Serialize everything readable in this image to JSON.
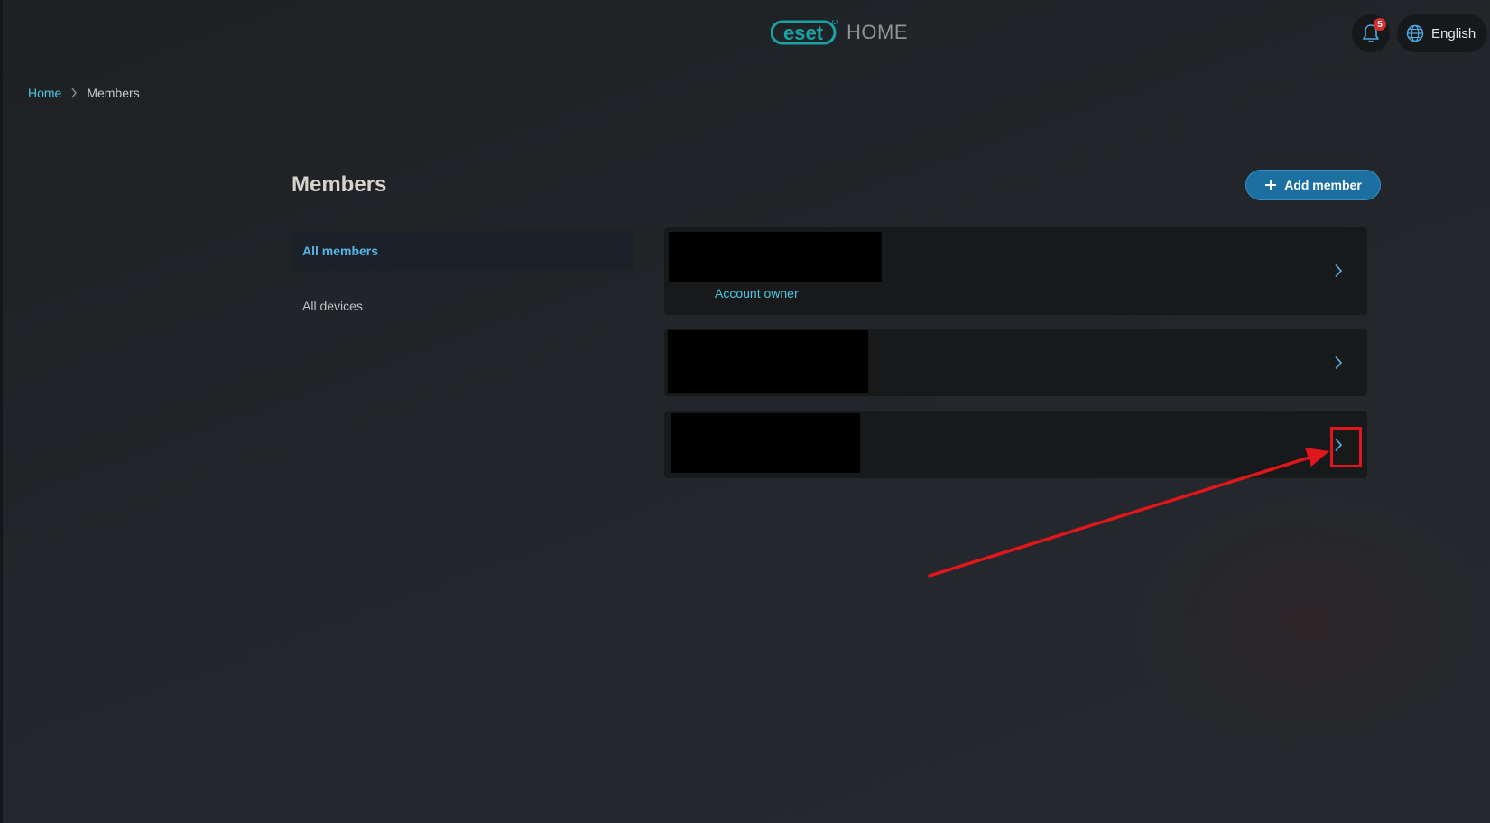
{
  "header": {
    "logo_text": "eset",
    "logo_suffix": "HOME",
    "notifications_count": "5",
    "language": "English"
  },
  "breadcrumb": {
    "home": "Home",
    "current": "Members"
  },
  "page": {
    "title": "Members",
    "add_member_label": "Add member"
  },
  "sidebar": {
    "items": [
      {
        "label": "All members",
        "active": true
      },
      {
        "label": "All devices",
        "active": false
      }
    ]
  },
  "members": [
    {
      "name": "",
      "role": "Account owner",
      "redacted": true
    },
    {
      "name": "",
      "role": "",
      "redacted": true
    },
    {
      "name": "",
      "role": "",
      "redacted": true
    }
  ],
  "icons": {
    "notification": "bell-icon",
    "language": "globe-icon",
    "add": "plus-icon",
    "chevron": "chevron-right-icon"
  },
  "colors": {
    "accent": "#4fc8e0",
    "primary_button": "#1c6fa1",
    "badge": "#d32f2f",
    "annotation": "#e0161c"
  }
}
